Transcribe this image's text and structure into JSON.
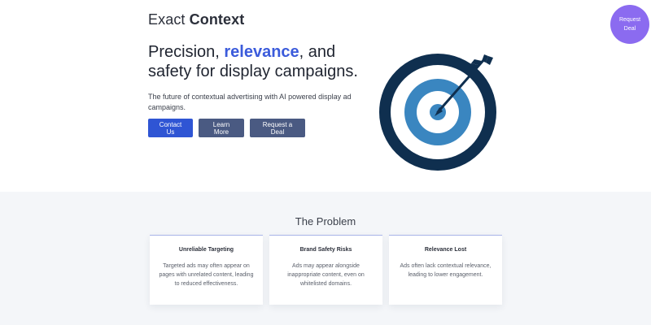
{
  "brand": {
    "light": "Exact",
    "bold": "Context"
  },
  "hero": {
    "headline_pre": "Precision, ",
    "headline_accent": "relevance",
    "headline_post": ", and safety for display campaigns.",
    "subtitle": "The future of contextual advertising with AI powered display ad campaigns.",
    "buttons": {
      "contact": "Contact Us",
      "learn": "Learn More",
      "deal": "Request a Deal"
    },
    "illustration_icon": "target-arrow-icon"
  },
  "floating": {
    "line1": "Request",
    "line2": "Deal"
  },
  "problem": {
    "title": "The Problem",
    "cards": [
      {
        "title": "Unreliable Targeting",
        "text": "Targeted ads may often appear on pages with unrelated content, leading to reduced effectiveness."
      },
      {
        "title": "Brand Safety Risks",
        "text": "Ads may appear alongside inappropriate content, even on whitelisted domains."
      },
      {
        "title": "Relevance Lost",
        "text": "Ads often lack contextual relevance, leading to lower engagement."
      }
    ]
  },
  "colors": {
    "accent": "#3b5bdb",
    "primary_button": "#2f55d4",
    "secondary_button": "#4a5a82",
    "target_dark": "#0f2f4f",
    "target_mid": "#3a86c0",
    "badge": "#8b6bf0"
  }
}
